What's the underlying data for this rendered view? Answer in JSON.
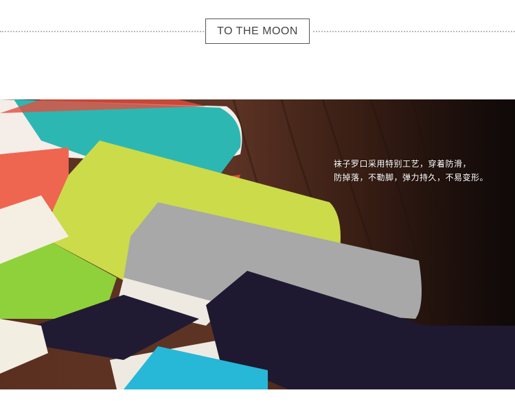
{
  "header": {
    "title": "TO THE MOON"
  },
  "photo": {
    "caption_line1": "袜子罗口采用特别工艺，穿着防滑，",
    "caption_line2": "防掉落，不勒脚，弹力持久，不易变形。"
  }
}
